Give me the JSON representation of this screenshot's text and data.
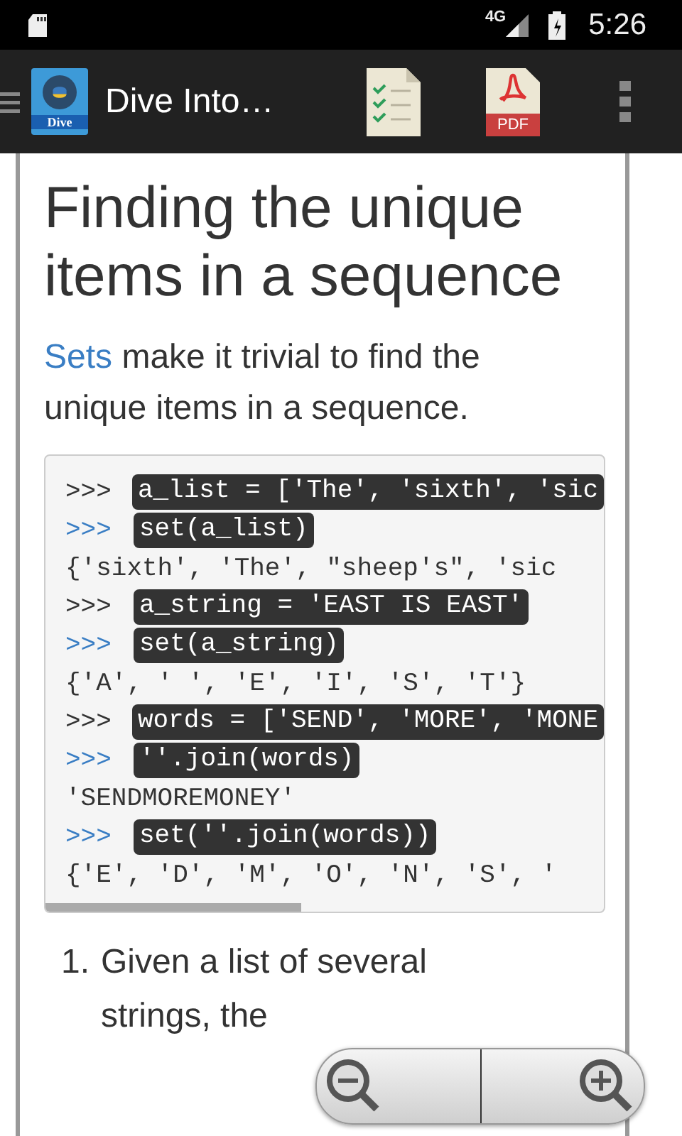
{
  "status_bar": {
    "network": "4G",
    "time": "5:26"
  },
  "app_bar": {
    "title": "Dive Into…",
    "book_label": "Dive",
    "pdf_label": "PDF"
  },
  "article": {
    "heading": "Finding the unique items in a sequence",
    "intro": {
      "link": "Sets",
      "text": "make it trivial to find the unique items in a sequence."
    },
    "code_lines": [
      {
        "kind": "input",
        "prompt": ">>>",
        "color": "#333333",
        "code": "a_list = ['The', 'sixth', 'sic"
      },
      {
        "kind": "input",
        "prompt": ">>>",
        "color": "#3a7ec4",
        "code": "set(a_list)"
      },
      {
        "kind": "output",
        "code": "{'sixth', 'The', \"sheep's\", 'sic"
      },
      {
        "kind": "input",
        "prompt": ">>>",
        "color": "#333333",
        "code": "a_string = 'EAST IS EAST'"
      },
      {
        "kind": "input",
        "prompt": ">>>",
        "color": "#3a7ec4",
        "code": "set(a_string)"
      },
      {
        "kind": "output",
        "code": "{'A', ' ', 'E', 'I', 'S', 'T'}"
      },
      {
        "kind": "input",
        "prompt": ">>>",
        "color": "#333333",
        "code": "words = ['SEND', 'MORE', 'MONE"
      },
      {
        "kind": "input",
        "prompt": ">>>",
        "color": "#3a7ec4",
        "code": "''.join(words)"
      },
      {
        "kind": "output",
        "code": "'SENDMOREMONEY'"
      },
      {
        "kind": "input",
        "prompt": ">>>",
        "color": "#3a7ec4",
        "code": "set(''.join(words))"
      },
      {
        "kind": "output",
        "code": "{'E', 'D', 'M', 'O', 'N', 'S', '"
      }
    ],
    "list_items": [
      {
        "number": "1.",
        "text": "Given a list of several strings, the"
      }
    ]
  }
}
